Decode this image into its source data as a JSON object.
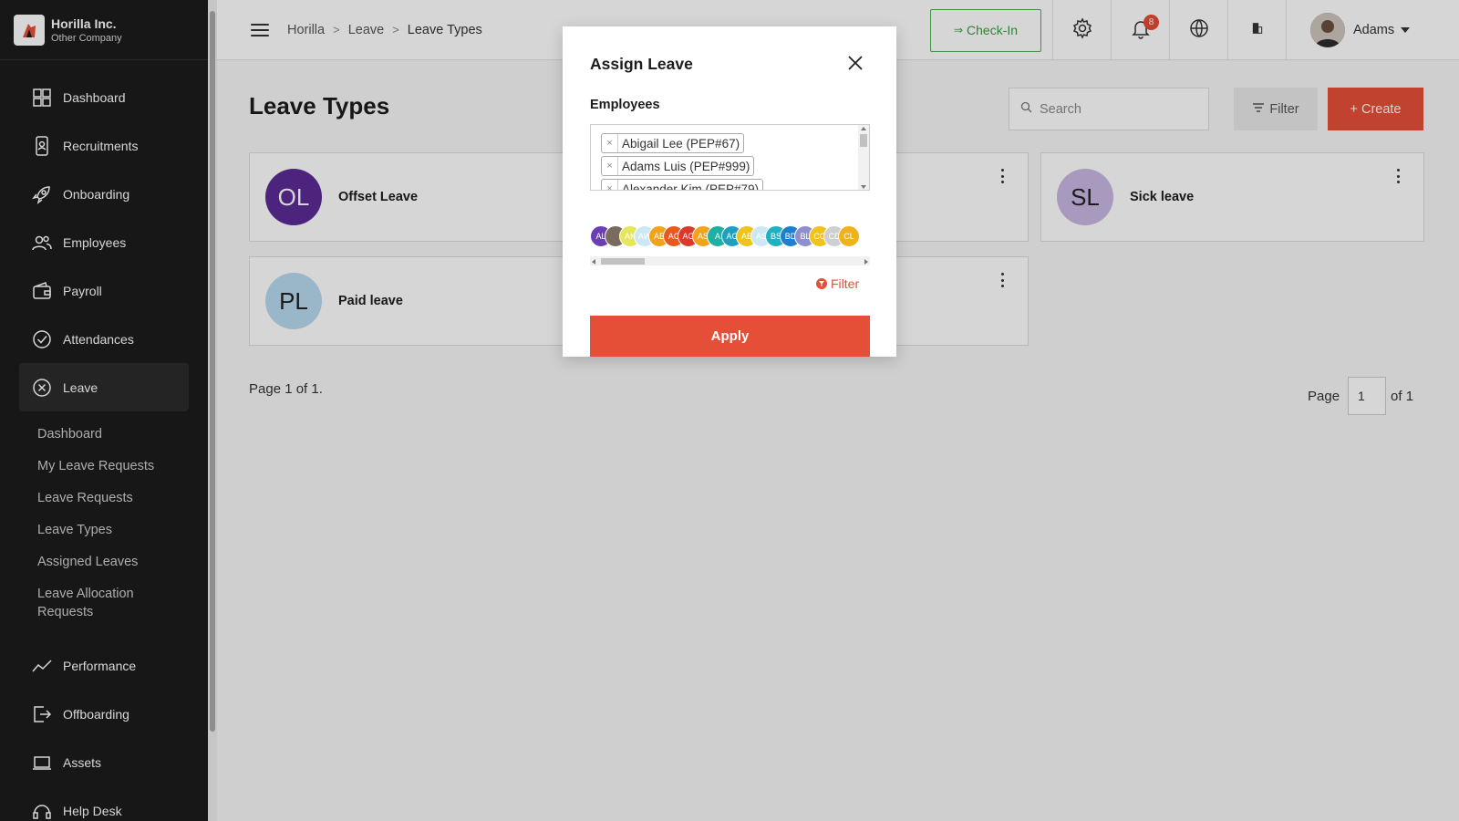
{
  "brand": {
    "name": "Horilla Inc.",
    "company": "Other Company"
  },
  "sidebar": {
    "items": [
      {
        "label": "Dashboard",
        "icon": "dashboard-icon"
      },
      {
        "label": "Recruitments",
        "icon": "recruitment-icon"
      },
      {
        "label": "Onboarding",
        "icon": "rocket-icon"
      },
      {
        "label": "Employees",
        "icon": "people-icon"
      },
      {
        "label": "Payroll",
        "icon": "wallet-icon"
      },
      {
        "label": "Attendances",
        "icon": "check-circle-icon"
      },
      {
        "label": "Leave",
        "icon": "x-circle-icon",
        "active": true
      },
      {
        "label": "Performance",
        "icon": "chart-line-icon"
      },
      {
        "label": "Offboarding",
        "icon": "exit-icon"
      },
      {
        "label": "Assets",
        "icon": "laptop-icon"
      },
      {
        "label": "Help Desk",
        "icon": "headset-icon"
      }
    ],
    "leave_sub": [
      "Dashboard",
      "My Leave Requests",
      "Leave Requests",
      "Leave Types",
      "Assigned Leaves",
      "Leave Allocation Requests"
    ]
  },
  "header": {
    "breadcrumb": [
      "Horilla",
      "Leave",
      "Leave Types"
    ],
    "checkin_label": "Check-In",
    "notification_count": "8",
    "user_name": "Adams"
  },
  "main": {
    "title": "Leave Types",
    "search_placeholder": "Search",
    "filter_label": "Filter",
    "create_label": "Create",
    "cards": [
      {
        "initials": "OL",
        "title": "Offset Leave",
        "bg": "#5b2c97",
        "fg": "#ffffff"
      },
      {
        "initials": "SL",
        "title": "Sick leave",
        "bg": "#c9b7e3",
        "fg": "#222222"
      },
      {
        "initials": "PL",
        "title": "Paid leave",
        "bg": "#b7daf0",
        "fg": "#222222"
      }
    ],
    "page_info": "Page 1 of 1.",
    "pager": {
      "label": "Page",
      "value": "1",
      "of": "of 1"
    }
  },
  "modal": {
    "title": "Assign Leave",
    "field_label": "Employees",
    "selected": [
      "Abigail Lee (PEP#67)",
      "Adams Luis (PEP#999)",
      "Alexander Kim (PEP#79)"
    ],
    "avatars": [
      {
        "t": "AL",
        "c": "#6a3fb3"
      },
      {
        "t": "",
        "c": "#7b6a5e"
      },
      {
        "t": "AK",
        "c": "#e6e65a"
      },
      {
        "t": "AW",
        "c": "#cde8f5"
      },
      {
        "t": "AB",
        "c": "#f0a31c"
      },
      {
        "t": "AC",
        "c": "#e65a1e"
      },
      {
        "t": "AG",
        "c": "#d93a2a"
      },
      {
        "t": "AS",
        "c": "#f0a31c"
      },
      {
        "t": "A",
        "c": "#1fb0a4"
      },
      {
        "t": "AG",
        "c": "#1f9fbf"
      },
      {
        "t": "AE",
        "c": "#f0c21c"
      },
      {
        "t": "AS",
        "c": "#cde8f5"
      },
      {
        "t": "BS",
        "c": "#1fb0c4"
      },
      {
        "t": "BD",
        "c": "#1f7fcf"
      },
      {
        "t": "BL",
        "c": "#8f8fcf"
      },
      {
        "t": "CO",
        "c": "#f0c21c"
      },
      {
        "t": "CD",
        "c": "#cfcfcf"
      },
      {
        "t": "CL",
        "c": "#f0b21c"
      }
    ],
    "filter_label": "Filter",
    "apply_label": "Apply"
  },
  "colors": {
    "accent": "#e54f38",
    "checkin": "#4caf50",
    "sidebar": "#1c1c1c"
  }
}
